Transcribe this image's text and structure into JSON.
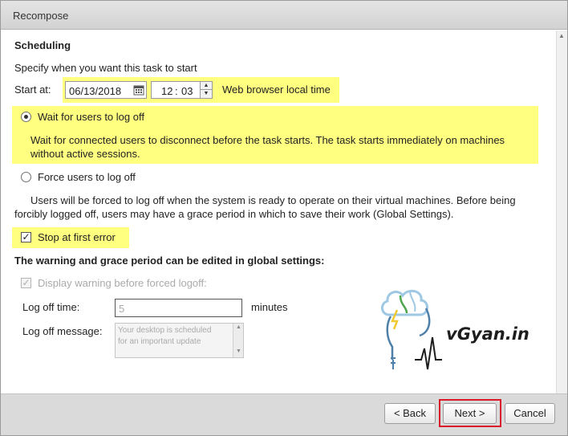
{
  "window": {
    "title": "Recompose"
  },
  "scheduling": {
    "heading": "Scheduling",
    "instruction": "Specify when you want this task to start",
    "start_label": "Start at:",
    "date_value": "06/13/2018",
    "time_hour": "12",
    "time_sep": ":",
    "time_minute": "03",
    "timezone_note": "Web browser local time"
  },
  "options": {
    "wait_label": "Wait for users to log off",
    "wait_desc_1": "Wait for connected users to disconnect before the task starts. The task starts immediately on machines",
    "wait_desc_2": "without active sessions.",
    "force_label": "Force users to log off",
    "force_desc_1": "Users will be forced to log off when the system is ready to operate on their virtual machines. Before being",
    "force_desc_2": "forcibly logged off, users may have a grace period in which to save their work (Global Settings).",
    "selected": "wait",
    "stop_label": "Stop at first error",
    "stop_checked": true
  },
  "warning": {
    "heading": "The warning and grace period can be edited in global settings:",
    "display_label": "Display warning before forced logoff:",
    "logoff_time_label": "Log off time:",
    "logoff_time_value": "5",
    "minutes_label": "minutes",
    "logoff_message_label": "Log off message:",
    "logoff_message_line1": "Your desktop is scheduled",
    "logoff_message_line2": "for an important update"
  },
  "watermark": {
    "text": "vGyan.in"
  },
  "buttons": {
    "back": "< Back",
    "next": "Next >",
    "cancel": "Cancel"
  },
  "colors": {
    "highlight": "#ffff80",
    "next_outline": "#d9182a",
    "footer_bg": "#dadada"
  }
}
